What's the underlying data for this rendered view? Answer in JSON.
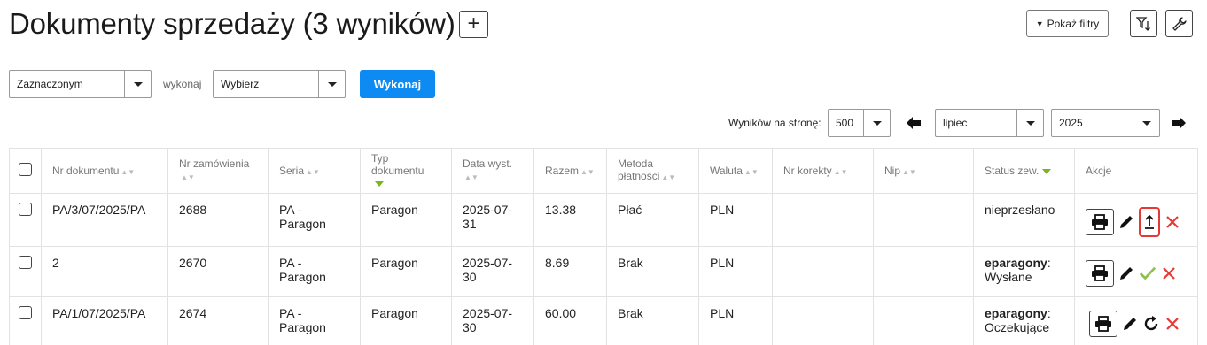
{
  "header": {
    "title": "Dokumenty sprzedaży (3 wyników)",
    "add_label": "+",
    "filters_label": "Pokaż filtry"
  },
  "bulk": {
    "scope_value": "Zaznaczonym",
    "do_label": "wykonaj",
    "action_value": "Wybierz",
    "execute_label": "Wykonaj"
  },
  "pagination": {
    "per_page_label": "Wyników na stronę:",
    "per_page_value": "500",
    "month_value": "lipiec",
    "year_value": "2025"
  },
  "table": {
    "columns": {
      "nr_dokumentu": "Nr dokumentu",
      "nr_zamowienia": "Nr zamówienia",
      "seria": "Seria",
      "typ_1": "Typ",
      "typ_2": "dokumentu",
      "data": "Data wyst.",
      "razem": "Razem",
      "metoda_1": "Metoda",
      "metoda_2": "płatności",
      "waluta": "Waluta",
      "nr_korekty": "Nr korekty",
      "nip": "Nip",
      "status": "Status zew.",
      "akcje": "Akcje"
    },
    "rows": [
      {
        "nr_dokumentu": "PA/3/07/2025/PA",
        "nr_zamowienia": "2688",
        "seria_1": "PA -",
        "seria_2": "Paragon",
        "typ": "Paragon",
        "data_1": "2025-07-",
        "data_2": "31",
        "razem": "13.38",
        "metoda": "Płać",
        "waluta": "PLN",
        "nr_korekty": "",
        "nip": "",
        "status_plain": "nieprzesłano"
      },
      {
        "nr_dokumentu": "2",
        "nr_zamowienia": "2670",
        "seria_1": "PA -",
        "seria_2": "Paragon",
        "typ": "Paragon",
        "data_1": "2025-07-",
        "data_2": "30",
        "razem": "8.69",
        "metoda": "Brak",
        "waluta": "PLN",
        "nr_korekty": "",
        "nip": "",
        "status_bold": "eparagony",
        "status_text": "Wysłane"
      },
      {
        "nr_dokumentu": "PA/1/07/2025/PA",
        "nr_zamowienia": "2674",
        "seria_1": "PA -",
        "seria_2": "Paragon",
        "typ": "Paragon",
        "data_1": "2025-07-",
        "data_2": "30",
        "razem": "60.00",
        "metoda": "Brak",
        "waluta": "PLN",
        "nr_korekty": "",
        "nip": "",
        "status_bold": "eparagony",
        "status_text": "Oczekujące"
      }
    ]
  },
  "icons": {
    "print": "printer-icon",
    "edit": "pencil-icon",
    "upload": "upload-icon",
    "sent": "check-icon",
    "pending": "refresh-icon",
    "delete": "close-icon",
    "filter_sort": "filter-sort-icon",
    "settings": "wrench-icon",
    "prev": "arrow-left-icon",
    "next": "arrow-right-icon"
  },
  "colors": {
    "primary": "#0d8bf2",
    "success": "#8bc34a",
    "danger": "#e53935",
    "sort_active": "#7ab51d"
  }
}
